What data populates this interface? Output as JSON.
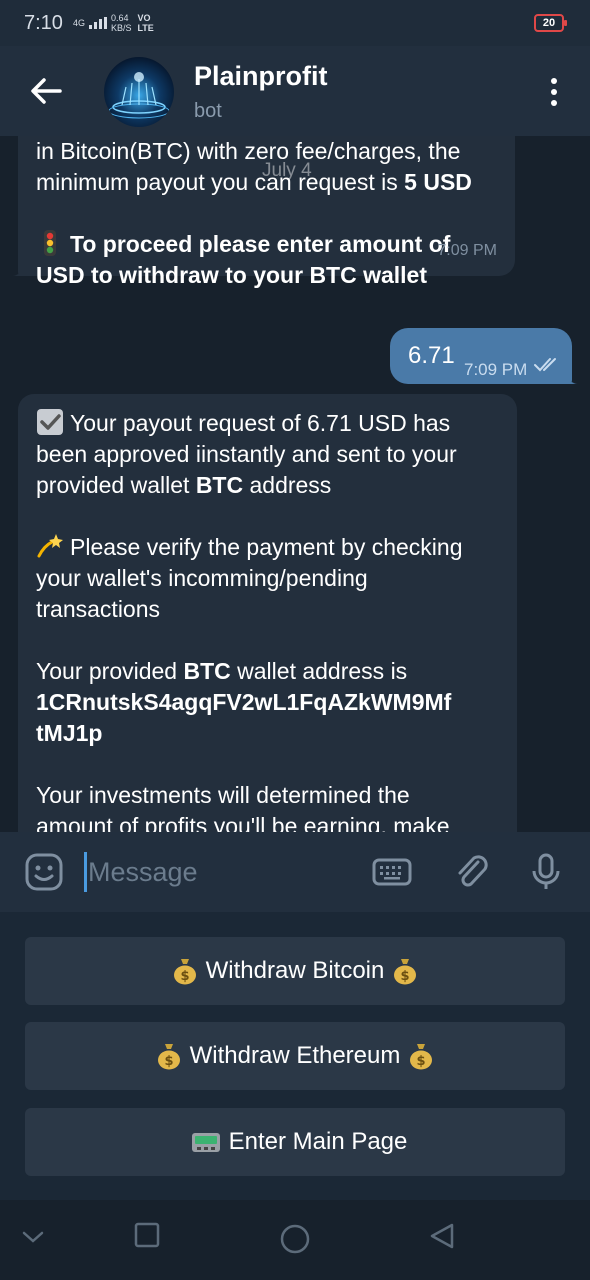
{
  "status": {
    "time": "7:10",
    "network": "4G",
    "speed_value": "0.64",
    "speed_unit": "KB/S",
    "lte_top": "VO",
    "lte_bottom": "LTE",
    "battery": "20"
  },
  "header": {
    "title": "Plainprofit",
    "subtitle": "bot"
  },
  "messages": {
    "m1": {
      "line1": "in Bitcoin(BTC) with zero fee/charges, the",
      "line2_a": "minimum payout you can request is ",
      "line2_b": "5 USD",
      "line3": "To proceed please enter amount of",
      "line4": "USD to withdraw to your BTC wallet",
      "time": "7:09 PM"
    },
    "date_overlay": "July 4",
    "m2": {
      "text": "6.71",
      "time": "7:09 PM"
    },
    "m3": {
      "l1": "Your payout request of 6.71 USD has",
      "l2": "been approved iinstantly and sent to your",
      "l3a": "provided wallet ",
      "l3b": "BTC",
      "l3c": " address",
      "l4": "Please verify the payment by checking",
      "l5": "your wallet's incomming/pending",
      "l6": "transactions",
      "l7a": "Your provided ",
      "l7b": "BTC",
      "l7c": " wallet address is",
      "l8": "1CRnutskS4agqFV2wL1FqAZkWM9Mf",
      "l9": "tMJ1p",
      "l10": "Your investments will determined the",
      "l11": "amount of profits you'll be earning, make"
    }
  },
  "input": {
    "placeholder": "Message"
  },
  "keyboard": {
    "b1": "Withdraw Bitcoin",
    "b2": "Withdraw Ethereum",
    "b3": "Enter Main Page"
  },
  "colors": {
    "background": "#17212c",
    "incoming_bubble": "#232f3d",
    "outgoing_bubble": "#4a7aa8",
    "header": "#222f3e",
    "accent": "#4a9be0"
  }
}
